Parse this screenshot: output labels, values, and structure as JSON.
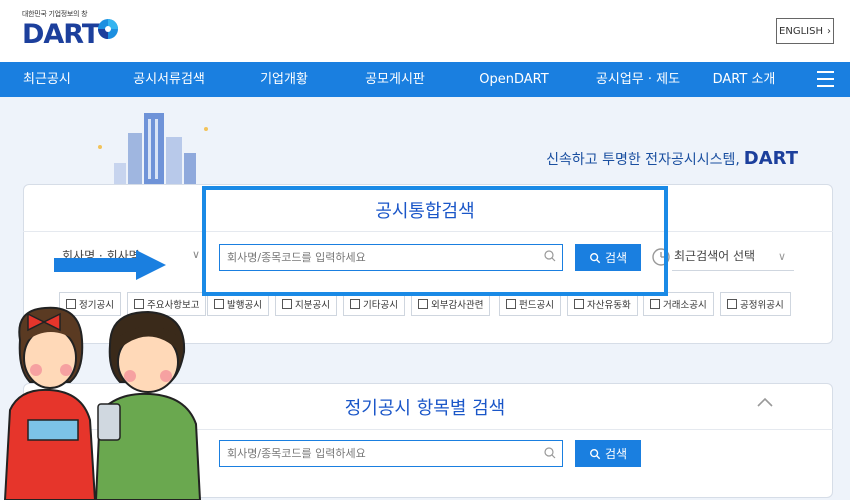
{
  "header": {
    "logo_sub": "대한민국 기업정보의 창",
    "logo_text": "DART",
    "english_button": "ENGLISH"
  },
  "nav": {
    "items": [
      "최근공시",
      "공시서류검색",
      "기업개황",
      "공모게시판",
      "OpenDART",
      "공시업무 · 제도",
      "DART 소개"
    ]
  },
  "banner": {
    "slogan": "신속하고 투명한 전자공시시스템,",
    "slogan_brand": "DART"
  },
  "integrated_search": {
    "title": "공시통합검색",
    "selector_label": "회사명 · 회사명",
    "input_placeholder": "회사명/종목코드를 입력하세요",
    "search_button": "검색",
    "recent_search": "최근검색어 선택",
    "filters": [
      "정기공시",
      "주요사항보고",
      "발행공시",
      "지분공시",
      "기타공시",
      "외부감사관련",
      "펀드공시",
      "자산유동화",
      "거래소공시",
      "공정위공시"
    ]
  },
  "periodic_search": {
    "title": "정기공시 항목별 검색",
    "input_placeholder": "회사명/종목코드를 입력하세요",
    "search_button": "검색"
  },
  "colors": {
    "nav_bg": "#1a7fe0",
    "brand": "#1c3f9c",
    "highlight": "#1a8ae6"
  }
}
